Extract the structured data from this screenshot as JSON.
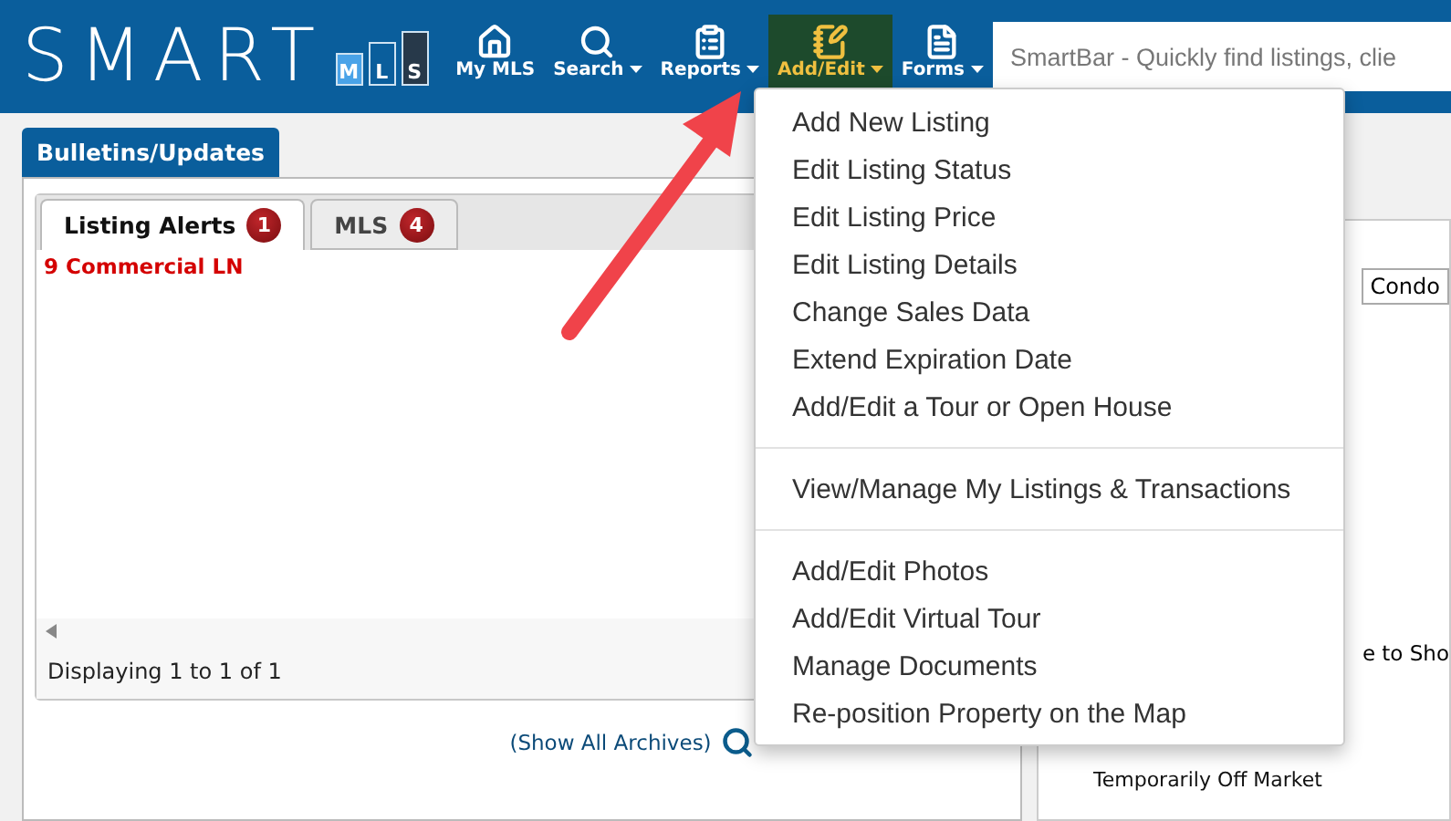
{
  "header": {
    "logo": {
      "text": "SMART",
      "boxes": [
        {
          "letter": "M",
          "kind": "filled"
        },
        {
          "letter": "L",
          "kind": "outline"
        },
        {
          "letter": "S",
          "kind": "dark"
        }
      ]
    },
    "nav": [
      {
        "label": "My MLS",
        "kind": "home",
        "caret": false,
        "selected": false
      },
      {
        "label": "Search",
        "kind": "search",
        "caret": true,
        "selected": false
      },
      {
        "label": "Reports",
        "kind": "reports",
        "caret": true,
        "selected": false
      },
      {
        "label": "Add/Edit",
        "kind": "edit",
        "caret": true,
        "selected": true
      },
      {
        "label": "Forms",
        "kind": "forms",
        "caret": true,
        "selected": false
      }
    ],
    "search": {
      "placeholder": "SmartBar - Quickly find listings, clie"
    }
  },
  "bulletins": {
    "title": "Bulletins/Updates",
    "tabs": [
      {
        "label": "Listing Alerts",
        "badge": "1",
        "selected": true
      },
      {
        "label": "MLS",
        "badge": "4",
        "selected": false
      }
    ],
    "alerts": [
      "9 Commercial LN"
    ],
    "footer": "Displaying 1 to 1 of 1",
    "archives_link": "(Show All Archives)"
  },
  "right_panel": {
    "field": "Condo",
    "text": "e to Sho",
    "status": "Temporarily Off Market"
  },
  "menu": {
    "groups": [
      [
        "Add New Listing",
        "Edit Listing Status",
        "Edit Listing Price",
        "Edit Listing Details",
        "Change Sales Data",
        "Extend Expiration Date",
        "Add/Edit a Tour or Open House"
      ],
      [
        "View/Manage My Listings & Transactions"
      ],
      [
        "Add/Edit Photos",
        "Add/Edit Virtual Tour",
        "Manage Documents",
        "Re-position Property on the Map"
      ]
    ]
  }
}
